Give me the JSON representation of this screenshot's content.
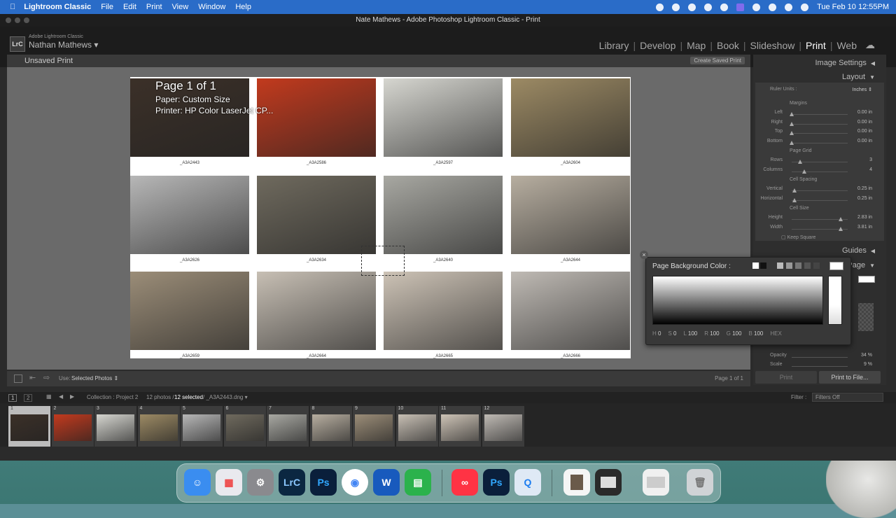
{
  "menubar": {
    "apple": "",
    "app_name": "Lightroom Classic",
    "items": [
      "File",
      "Edit",
      "Print",
      "View",
      "Window",
      "Help"
    ],
    "clock": "Tue Feb 10  12:55PM"
  },
  "window": {
    "title": "Nate Mathews - Adobe Photoshop Lightroom Classic - Print",
    "badge": "LrC",
    "adobe_label": "Adobe Lightroom Classic",
    "user": "Nathan Mathews",
    "modules": [
      "Library",
      "Develop",
      "Map",
      "Book",
      "Slideshow",
      "Print",
      "Web"
    ],
    "active_module": "Print"
  },
  "toolbar_top": {
    "title": "Unsaved Print",
    "create_saved": "Create Saved Print"
  },
  "page_info": {
    "line1": "Page 1 of 1",
    "line2": "Paper:  Custom Size",
    "line3": "Printer:  HP Color LaserJet CP..."
  },
  "photos": [
    {
      "caption": "_A3A2443",
      "color": "#3b3028"
    },
    {
      "caption": "_A3A2586",
      "color": "#c23a1e"
    },
    {
      "caption": "_A3A2597",
      "color": "#d6d6d0"
    },
    {
      "caption": "_A3A2604",
      "color": "#9c8a64"
    },
    {
      "caption": "_A3A2626",
      "color": "#b7b7b7"
    },
    {
      "caption": "_A3A2634",
      "color": "#6f6a5e"
    },
    {
      "caption": "_A3A2640",
      "color": "#a8a8a2"
    },
    {
      "caption": "_A3A2644",
      "color": "#b7aea0"
    },
    {
      "caption": "_A3A2659",
      "color": "#9b8d78"
    },
    {
      "caption": "_A3A2664",
      "color": "#c7bfb4"
    },
    {
      "caption": "_A3A2665",
      "color": "#cdc3b6"
    },
    {
      "caption": "_A3A2666",
      "color": "#bfbab4"
    }
  ],
  "placeholder_text": "Nate",
  "toolbar_bottom": {
    "use_label": "Use:",
    "use_value": "Selected Photos",
    "page_count": "Page 1 of 1"
  },
  "right_panel": {
    "image_settings": "Image Settings",
    "layout": "Layout",
    "ruler_units_label": "Ruler Units :",
    "ruler_units_value": "Inches",
    "margins_header": "Margins",
    "margins": [
      {
        "label": "Left",
        "value": "0.00 in"
      },
      {
        "label": "Right",
        "value": "0.00 in"
      },
      {
        "label": "Top",
        "value": "0.00 in"
      },
      {
        "label": "Bottom",
        "value": "0.00 in"
      }
    ],
    "page_grid_header": "Page Grid",
    "page_grid": [
      {
        "label": "Rows",
        "value": "3"
      },
      {
        "label": "Columns",
        "value": "4"
      }
    ],
    "cell_spacing_header": "Cell Spacing",
    "cell_spacing": [
      {
        "label": "Vertical",
        "value": "0.25 in"
      },
      {
        "label": "Horizontal",
        "value": "0.25 in"
      }
    ],
    "cell_size_header": "Cell Size",
    "cell_size": [
      {
        "label": "Height",
        "value": "2.83 in"
      },
      {
        "label": "Width",
        "value": "3.81 in"
      }
    ],
    "keep_square": "Keep Square",
    "guides": "Guides",
    "page": "Page",
    "opacity_label": "Opacity",
    "opacity_value": "34 %",
    "scale_label": "Scale",
    "scale_value": "9 %",
    "print_button": "Print",
    "print_to_file_button": "Print to File..."
  },
  "color_picker": {
    "title": "Page Background Color :",
    "readout": [
      {
        "label": "H",
        "value": "0"
      },
      {
        "label": "S",
        "value": "0"
      },
      {
        "label": "L",
        "value": "100"
      },
      {
        "label": "R",
        "value": "100"
      },
      {
        "label": "G",
        "value": "100"
      },
      {
        "label": "B",
        "value": "100"
      },
      {
        "label": "HEX",
        "value": ""
      }
    ]
  },
  "filmstrip": {
    "collection": "Collection : Project 2",
    "count": "12 photos /",
    "selected": "12 selected",
    "file": "/ _A3A2443.dng",
    "filter_label": "Filter :",
    "filter_value": "Filters Off",
    "page_buttons": [
      "1",
      "2"
    ]
  },
  "dock": {
    "apps": [
      "Finder",
      "Launchpad",
      "System Settings",
      "Lightroom Classic",
      "Photoshop",
      "Chrome",
      "Word",
      "Numbers",
      "Creative Cloud",
      "Photoshop",
      "QuickTime"
    ]
  }
}
